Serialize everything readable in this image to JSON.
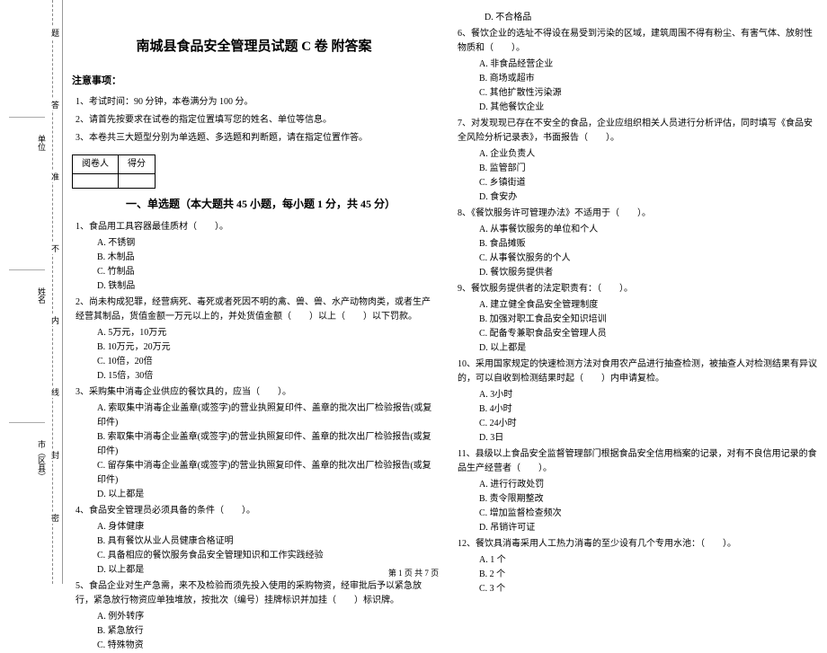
{
  "binding": {
    "labels": [
      "市（区县）",
      "姓名",
      "单位"
    ],
    "vert_marks": [
      "密",
      "封",
      "线",
      "内",
      "不",
      "准",
      "答",
      "题"
    ]
  },
  "header": {
    "title": "南城县食品安全管理员试题 C 卷 附答案",
    "notice_head": "注意事项：",
    "notices": [
      "1、考试时间：90 分钟，本卷满分为 100 分。",
      "2、请首先按要求在试卷的指定位置填写您的姓名、单位等信息。",
      "3、本卷共三大题型分别为单选题、多选题和判断题，请在指定位置作答。"
    ],
    "score_table": {
      "c1": "阅卷人",
      "c2": "得分"
    }
  },
  "section1": {
    "title": "一、单选题（本大题共 45 小题，每小题 1 分，共 45 分）"
  },
  "left_questions": [
    {
      "q": "1、食品用工具容器最佳质材（　　）。",
      "opts": [
        "A. 不锈钢",
        "B. 木制品",
        "C. 竹制品",
        "D. 铁制品"
      ]
    },
    {
      "q": "2、尚未构成犯罪，经营病死、毒死或者死因不明的禽、兽、兽、水产动物肉类，或者生产经营其制品，货值金额一万元以上的，并处货值金额（　　）以上（　　）以下罚款。",
      "opts": [
        "A. 5万元，10万元",
        "B. 10万元，20万元",
        "C. 10倍，20倍",
        "D. 15倍，30倍"
      ]
    },
    {
      "q": "3、采购集中消毒企业供应的餐饮具的，应当（　　）。",
      "opts": [
        "A. 索取集中消毒企业盖章(或签字)的营业执照复印件、盖章的批次出厂检验报告(或复印件)",
        "B. 索取集中消毒企业盖章(或签字)的营业执照复印件、盖章的批次出厂检验报告(或复印件)",
        "C. 留存集中消毒企业盖章(或签字)的营业执照复印件、盖章的批次出厂检验报告(或复印件)",
        "D. 以上都是"
      ]
    },
    {
      "q": "4、食品安全管理员必须具备的条件（　　）。",
      "opts": [
        "A. 身体健康",
        "B. 具有餐饮从业人员健康合格证明",
        "C. 具备相应的餐饮服务食品安全管理知识和工作实践经验",
        "D. 以上都是"
      ]
    },
    {
      "q": "5、食品企业对生产急需，来不及检验而须先投入使用的采购物资，经审批后予以紧急放行，紧急放行物资应单独堆放，按批次（编号）挂牌标识并加挂（　　）标识牌。",
      "opts": [
        "A. 例外转序",
        "B. 紧急放行",
        "C. 特殊物资"
      ]
    }
  ],
  "right_questions": [
    {
      "q": "　　　D. 不合格品",
      "opts": []
    },
    {
      "q": "6、餐饮企业的选址不得设在易受到污染的区域，建筑周围不得有粉尘、有害气体、放射性物质和（　　）。",
      "opts": [
        "A. 非食品经营企业",
        "B. 商场或超市",
        "C. 其他扩散性污染源",
        "D. 其他餐饮企业"
      ]
    },
    {
      "q": "7、对发现现已存在不安全的食品，企业应组织相关人员进行分析评估，同时填写《食品安全风险分析记录表》，书面报告（　　）。",
      "opts": [
        "A. 企业负责人",
        "B. 监管部门",
        "C. 乡镇街道",
        "D. 食安办"
      ]
    },
    {
      "q": "8、《餐饮服务许可管理办法》不适用于（　　）。",
      "opts": [
        "A. 从事餐饮服务的单位和个人",
        "B. 食品摊贩",
        "C. 从事餐饮服务的个人",
        "D. 餐饮服务提供者"
      ]
    },
    {
      "q": "9、餐饮服务提供者的法定职责有：（　　）。",
      "opts": [
        "A. 建立健全食品安全管理制度",
        "B. 加强对职工食品安全知识培训",
        "C. 配备专兼职食品安全管理人员",
        "D. 以上都是"
      ]
    },
    {
      "q": "10、采用国家规定的快速检测方法对食用农产品进行抽查检测，被抽查人对检测结果有异议的，可以自收到检测结果时起（　　）内申请复检。",
      "opts": [
        "A. 3小时",
        "B. 4小时",
        "C. 24小时",
        "D. 3日"
      ]
    },
    {
      "q": "11、县级以上食品安全监督管理部门根据食品安全信用档案的记录，对有不良信用记录的食品生产经营者（　　）。",
      "opts": [
        "A. 进行行政处罚",
        "B. 责令限期整改",
        "C. 增加监督检查频次",
        "D. 吊销许可证"
      ]
    },
    {
      "q": "12、餐饮具消毒采用人工热力消毒的至少设有几个专用水池：（　　）。",
      "opts": [
        "A. 1 个",
        "B. 2 个",
        "C. 3 个"
      ]
    }
  ],
  "footer": "第 1 页 共 7 页"
}
